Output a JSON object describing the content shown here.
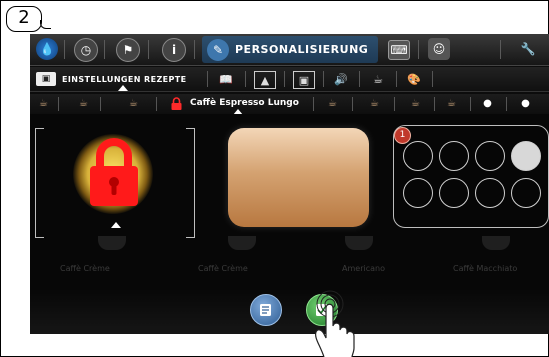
{
  "figure": {
    "step_number": "2"
  },
  "header": {
    "tabs": [
      {
        "icon": "water-drop-icon"
      },
      {
        "icon": "clock-icon"
      },
      {
        "icon": "flag-icon"
      },
      {
        "icon": "info-icon"
      },
      {
        "icon": "pen-icon",
        "label": "PERSONALISIERUNG",
        "active": true
      },
      {
        "icon": "keyboard-icon"
      },
      {
        "icon": "user-icon"
      },
      {
        "icon": "wrench-icon"
      }
    ]
  },
  "submenu": {
    "active_label": "EINSTELLUNGEN REZEPTE",
    "items": [
      "book-icon",
      "profile-card-icon",
      "image-icon",
      "screen-icon",
      "speaker-icon",
      "coffee-machine-icon",
      "palette-icon"
    ]
  },
  "recipes": {
    "selected": "Caffè Espresso Lungo",
    "locked": true
  },
  "content": {
    "cups_count_badge": "1",
    "cups_total": 8,
    "cups_filled": 1,
    "faded_labels": [
      "Caffè Crème",
      "Caffè Crème",
      "Americano",
      "Caffè Macchiato"
    ]
  },
  "actions": {
    "edit_icon": "edit-list-icon",
    "confirm_icon": "confirm-icon"
  },
  "colors": {
    "lock": "#ff1a1a",
    "preview_top": "#f3d6b7",
    "preview_bottom": "#b87840",
    "edit_button": "#3e77ad",
    "confirm_button": "#2a8a34"
  }
}
